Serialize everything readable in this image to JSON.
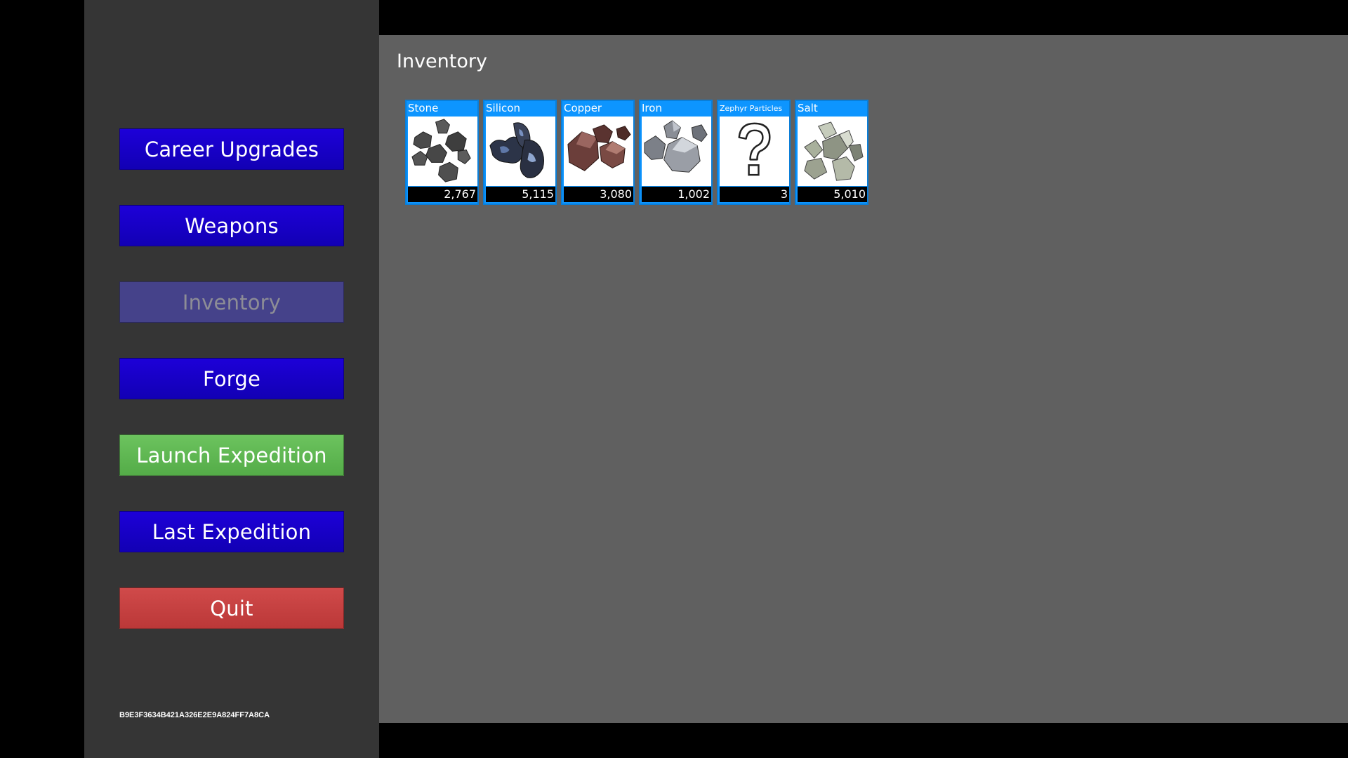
{
  "menu": {
    "career_upgrades": "Career Upgrades",
    "weapons": "Weapons",
    "inventory": "Inventory",
    "forge": "Forge",
    "launch_expedition": "Launch Expedition",
    "last_expedition": "Last Expedition",
    "quit": "Quit"
  },
  "build_id": "B9E3F3634B421A326E2E9A824FF7A8CA",
  "panel": {
    "title": "Inventory"
  },
  "items": [
    {
      "name": "Stone",
      "count": "2,767",
      "icon": "stone-icon"
    },
    {
      "name": "Silicon",
      "count": "5,115",
      "icon": "silicon-icon"
    },
    {
      "name": "Copper",
      "count": "3,080",
      "icon": "copper-icon"
    },
    {
      "name": "Iron",
      "count": "1,002",
      "icon": "iron-icon"
    },
    {
      "name": "Zephyr Particles",
      "count": "3",
      "icon": "question-mark-icon"
    },
    {
      "name": "Salt",
      "count": "5,010",
      "icon": "salt-icon"
    }
  ],
  "colors": {
    "button_blue": "#1500c4",
    "button_disabled": "#45428a",
    "button_green": "#5fb852",
    "button_red": "#c54141",
    "card_blue": "#0d95ff",
    "panel_bg": "#606060",
    "sidebar_bg": "#353535"
  }
}
